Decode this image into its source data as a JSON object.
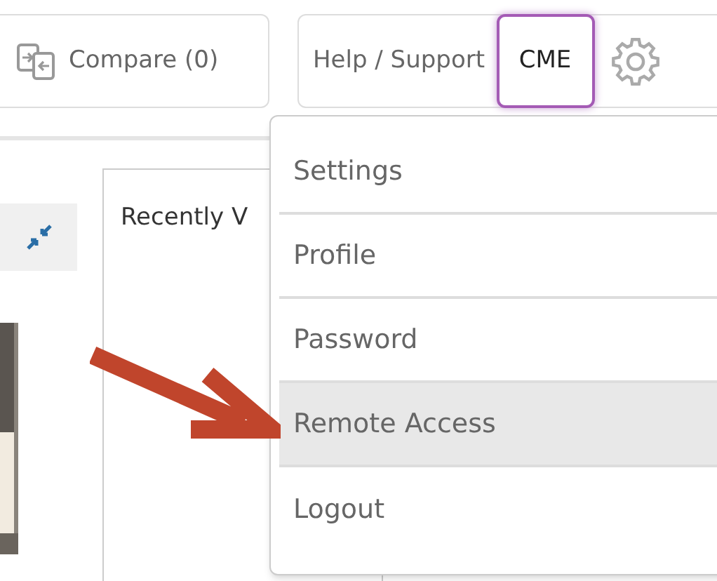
{
  "toolbar": {
    "compare": "Compare (0)",
    "help": "Help / Support",
    "cme": {
      "label": "CME",
      "selected": true
    }
  },
  "panel": {
    "title": "Recently V"
  },
  "menu": [
    {
      "label": "Settings",
      "selected": false
    },
    {
      "label": "Profile",
      "selected": false
    },
    {
      "label": "Password",
      "selected": false
    },
    {
      "label": "Remote Access",
      "selected": true
    },
    {
      "label": "Logout",
      "selected": false
    }
  ]
}
